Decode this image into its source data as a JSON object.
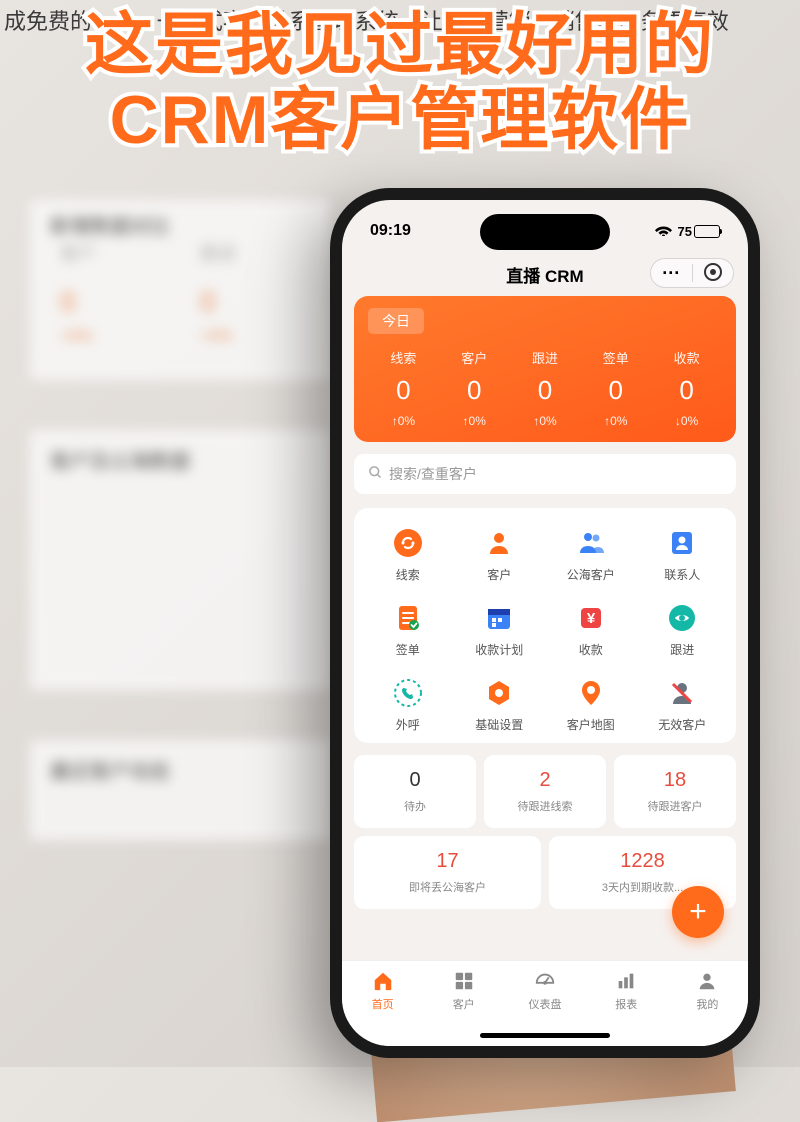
{
  "bg": {
    "header": "成免费的 crm，一站式客户关系管理系统，让企业营销、销售、服务更高效",
    "panel1_title": "新增数据对比",
    "panel2_title": "客户及公海数据",
    "panel3_title": "最近客户动态",
    "stat1_label": "客户",
    "stat2_label": "跟进",
    "stat_num": "0",
    "stat_pct": "+0%"
  },
  "headline_l1": "这是我见过最好用的",
  "headline_l2": "CRM客户管理软件",
  "status": {
    "time": "09:19",
    "battery": "75"
  },
  "app_title": "直播 CRM",
  "today": {
    "label": "今日",
    "stats": [
      {
        "label": "线索",
        "value": "0",
        "pct": "↑0%"
      },
      {
        "label": "客户",
        "value": "0",
        "pct": "↑0%"
      },
      {
        "label": "跟进",
        "value": "0",
        "pct": "↑0%"
      },
      {
        "label": "签单",
        "value": "0",
        "pct": "↑0%"
      },
      {
        "label": "收款",
        "value": "0",
        "pct": "↓0%"
      }
    ]
  },
  "search_placeholder": "搜索/查重客户",
  "grid": [
    {
      "label": "线索",
      "icon": "lead-icon",
      "color": "#ff6b1a"
    },
    {
      "label": "客户",
      "icon": "customer-icon",
      "color": "#ff6b1a"
    },
    {
      "label": "公海客户",
      "icon": "public-customer-icon",
      "color": "#3b82f6"
    },
    {
      "label": "联系人",
      "icon": "contact-icon",
      "color": "#3b82f6"
    },
    {
      "label": "签单",
      "icon": "order-icon",
      "color": "#ff6b1a"
    },
    {
      "label": "收款计划",
      "icon": "payment-plan-icon",
      "color": "#3b82f6"
    },
    {
      "label": "收款",
      "icon": "payment-icon",
      "color": "#ef4444"
    },
    {
      "label": "跟进",
      "icon": "followup-icon",
      "color": "#14b8a6"
    },
    {
      "label": "外呼",
      "icon": "outcall-icon",
      "color": "#14b8a6"
    },
    {
      "label": "基础设置",
      "icon": "settings-icon",
      "color": "#ff6b1a"
    },
    {
      "label": "客户地图",
      "icon": "map-icon",
      "color": "#ff6b1a"
    },
    {
      "label": "无效客户",
      "icon": "invalid-customer-icon",
      "color": "#6b7280"
    }
  ],
  "tasks_row1": [
    {
      "num": "0",
      "label": "待办",
      "red": false
    },
    {
      "num": "2",
      "label": "待跟进线索",
      "red": true
    },
    {
      "num": "18",
      "label": "待跟进客户",
      "red": true
    }
  ],
  "tasks_row2": [
    {
      "num": "17",
      "label": "即将丢公海客户",
      "red": true
    },
    {
      "num": "1228",
      "label": "3天内到期收款...",
      "red": true
    }
  ],
  "nav": [
    {
      "label": "首页",
      "icon": "home-icon",
      "active": true
    },
    {
      "label": "客户",
      "icon": "customers-icon",
      "active": false
    },
    {
      "label": "仪表盘",
      "icon": "dashboard-icon",
      "active": false
    },
    {
      "label": "报表",
      "icon": "report-icon",
      "active": false
    },
    {
      "label": "我的",
      "icon": "profile-icon",
      "active": false
    }
  ]
}
